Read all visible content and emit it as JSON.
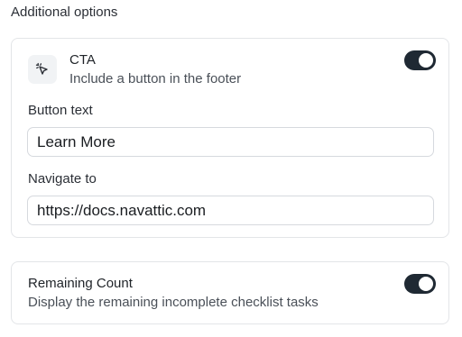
{
  "section_title": "Additional options",
  "cta": {
    "icon": "cursor-click-icon",
    "title": "CTA",
    "description": "Include a button in the footer",
    "enabled": true,
    "button_text_label": "Button text",
    "button_text_value": "Learn More",
    "navigate_label": "Navigate to",
    "navigate_value": "https://docs.navattic.com"
  },
  "remaining_count": {
    "title": "Remaining Count",
    "description": "Display the remaining incomplete checklist tasks",
    "enabled": true
  },
  "colors": {
    "toggle_on": "#1f2933",
    "border": "#e3e5e8"
  }
}
